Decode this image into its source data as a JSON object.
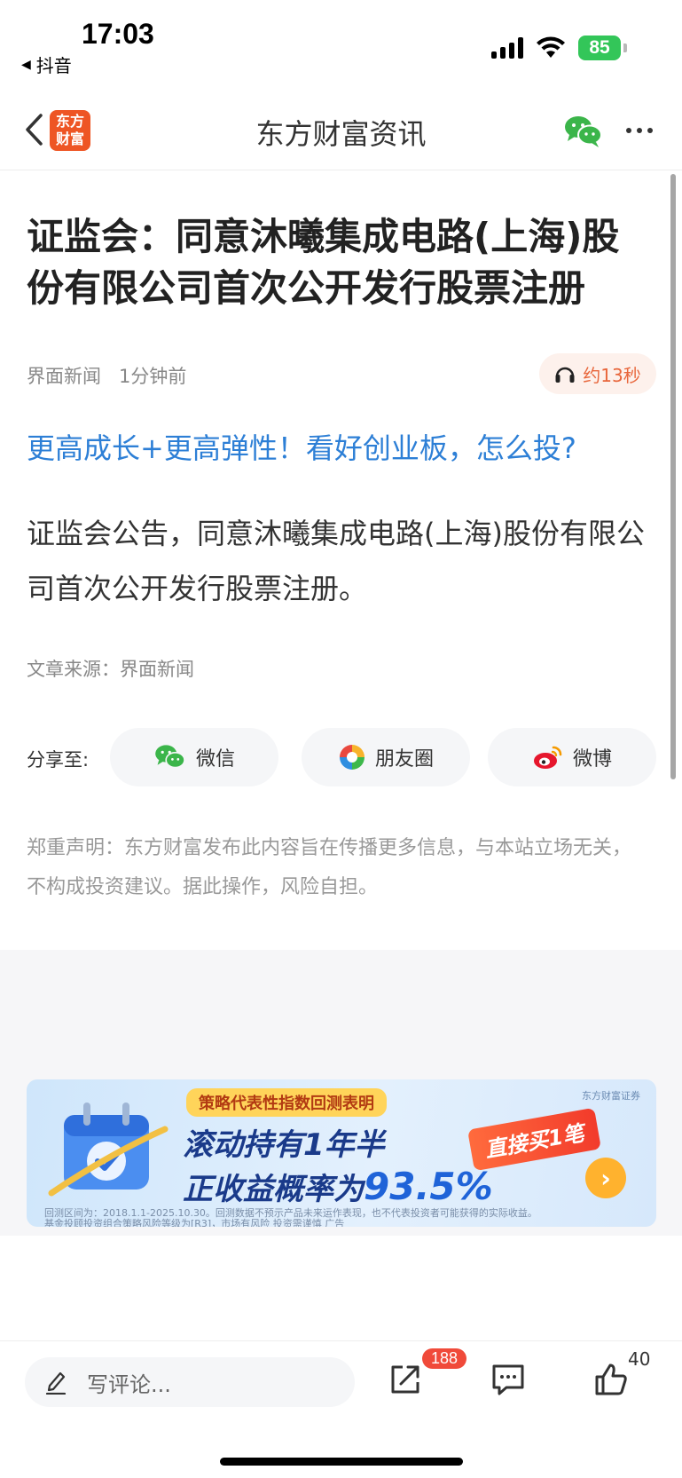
{
  "status_bar": {
    "time": "17:03",
    "back_app": "抖音",
    "battery": "85"
  },
  "nav": {
    "logo_line1": "东方",
    "logo_line2": "财富",
    "title": "东方财富资讯"
  },
  "article": {
    "title": "证监会：同意沐曦集成电路(上海)股份有限公司首次公开发行股票注册",
    "source_name": "界面新闻",
    "time_ago": "1分钟前",
    "listen_label": "约13秒",
    "promo_link": "更高成长+更高弹性！看好创业板，怎么投?",
    "body": "证监会公告，同意沐曦集成电路(上海)股份有限公司首次公开发行股票注册。",
    "source_line": "文章来源：界面新闻"
  },
  "share": {
    "label": "分享至:",
    "buttons": [
      {
        "label": "微信",
        "icon": "wechat-icon"
      },
      {
        "label": "朋友圈",
        "icon": "moments-icon"
      },
      {
        "label": "微博",
        "icon": "weibo-icon"
      }
    ]
  },
  "disclaimer": {
    "title": "郑重声明",
    "text": "郑重声明：东方财富发布此内容旨在传播更多信息，与本站立场无关，不构成投资建议。据此操作，风险自担。"
  },
  "banner": {
    "tag": "策略代表性指数回测表明",
    "line1": "滚动持有1年半",
    "line2_prefix": "正收益概率为",
    "line2_pct": "93.5%",
    "cta": "直接买1笔",
    "brand": "东方财富证券",
    "fine1": "回测区间为：2018.1.1-2025.10.30。回测数据不预示产品未来运作表现，也不代表投资者可能获得的实际收益。",
    "fine2": "基金投顾投资组合策略风险等级为[R3]，市场有风险 投资需谨慎 广告"
  },
  "bottom": {
    "comment_placeholder": "写评论...",
    "share_count": "188",
    "like_count": "40"
  },
  "colors": {
    "accent_blue": "#2d7fd6",
    "logo_orange": "#ee5524",
    "listen_orange": "#e8663b",
    "badge_red": "#f04a3a",
    "battery_green": "#33c659"
  }
}
